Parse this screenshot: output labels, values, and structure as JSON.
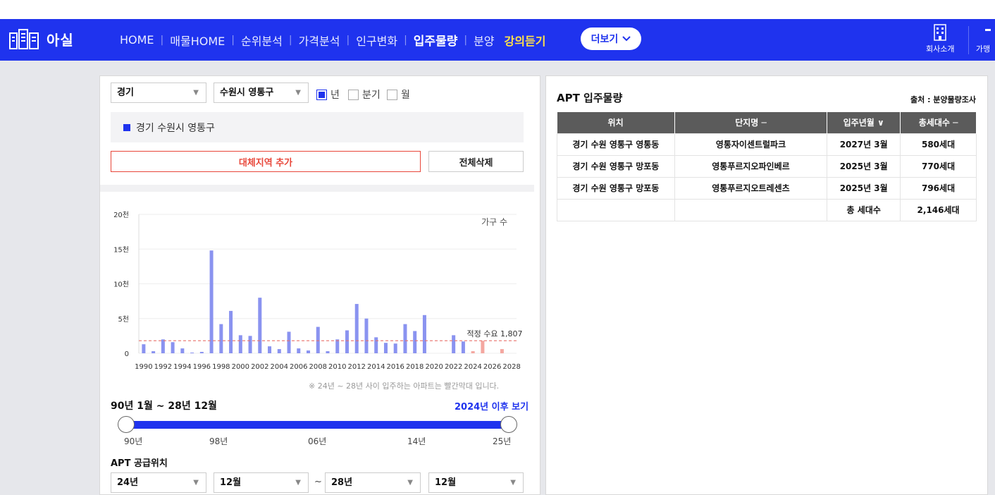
{
  "nav": {
    "logo_text": "아실",
    "menu": [
      {
        "label": "HOME",
        "style": "normal"
      },
      {
        "label": "매물HOME",
        "style": "normal"
      },
      {
        "label": "순위분석",
        "style": "normal"
      },
      {
        "label": "가격분석",
        "style": "normal"
      },
      {
        "label": "인구변화",
        "style": "normal"
      },
      {
        "label": "입주물량",
        "style": "active"
      },
      {
        "label": "분양",
        "style": "normal"
      },
      {
        "label": "강의듣기",
        "style": "yellow"
      }
    ],
    "more_label": "더보기",
    "company_label": "회사소개",
    "join_label": "가맹",
    "bg_color": "#1f33ee"
  },
  "filters": {
    "province": "경기",
    "city": "수원시 영통구",
    "period_options": [
      {
        "label": "년",
        "checked": true
      },
      {
        "label": "분기",
        "checked": false
      },
      {
        "label": "월",
        "checked": false
      }
    ]
  },
  "region": {
    "selected": "경기 수원시 영통구",
    "add_button": "대체지역 추가",
    "delete_all_button": "전체삭제"
  },
  "chart_data": {
    "type": "bar",
    "ylabel": "가구 수",
    "ylim": [
      0,
      20000
    ],
    "yticks": [
      {
        "value": 0,
        "label": "0"
      },
      {
        "value": 5000,
        "label": "5천"
      },
      {
        "value": 10000,
        "label": "10천"
      },
      {
        "value": 15000,
        "label": "15천"
      },
      {
        "value": 20000,
        "label": "20천"
      }
    ],
    "xticks": [
      "1990",
      "1992",
      "1994",
      "1996",
      "1998",
      "2000",
      "2002",
      "2004",
      "2006",
      "2008",
      "2010",
      "2012",
      "2014",
      "2016",
      "2018",
      "2020",
      "2022",
      "2024",
      "2026",
      "2028"
    ],
    "years": [
      1990,
      1991,
      1992,
      1993,
      1994,
      1995,
      1996,
      1997,
      1998,
      1999,
      2000,
      2001,
      2002,
      2003,
      2004,
      2005,
      2006,
      2007,
      2008,
      2009,
      2010,
      2011,
      2012,
      2013,
      2014,
      2015,
      2016,
      2017,
      2018,
      2019,
      2020,
      2021,
      2022,
      2023,
      2024,
      2025,
      2026,
      2027,
      2028
    ],
    "values": [
      1300,
      300,
      2000,
      1600,
      700,
      100,
      200,
      14800,
      4200,
      6100,
      2600,
      2500,
      8000,
      1000,
      600,
      3100,
      700,
      400,
      3800,
      300,
      2000,
      3300,
      7100,
      5000,
      2300,
      1500,
      1400,
      4200,
      3200,
      5500,
      0,
      0,
      2600,
      1700,
      300,
      1800,
      0,
      600,
      0
    ],
    "future_from": 2024,
    "bar_color": "#8a93f0",
    "future_bar_color": "#f4a7a0",
    "reference_line": {
      "value": 1807,
      "label": "적정 수요 1,807",
      "color": "#e8706a"
    },
    "grid": true
  },
  "chart_note": "※ 24년 ~ 28년 사이 입주하는 아파트는 빨간막대 입니다.",
  "range": {
    "label": "90년 1월 ~ 28년 12월",
    "link": "2024년 이후 보기",
    "ticks": [
      "90년",
      "98년",
      "06년",
      "14년",
      "25년"
    ]
  },
  "supply": {
    "title": "APT 공급위치",
    "from_year": "24년",
    "from_month": "12월",
    "tilde": "~",
    "to_year": "28년",
    "to_month": "12월"
  },
  "apt_table": {
    "title": "APT 입주물량",
    "source": "출처 : 분양물량조사",
    "headers": [
      "위치",
      "단지명 ─",
      "입주년월 ∨",
      "총세대수 ─"
    ],
    "rows": [
      [
        "경기 수원 영통구 영통동",
        "영통자이센트럴파크",
        "2027년 3월",
        "580세대"
      ],
      [
        "경기 수원 영통구 망포동",
        "영통푸르지오파인베르",
        "2025년 3월",
        "770세대"
      ],
      [
        "경기 수원 영통구 망포동",
        "영통푸르지오트레센츠",
        "2025년 3월",
        "796세대"
      ]
    ],
    "total_label": "총 세대수",
    "total_value": "2,146세대"
  }
}
